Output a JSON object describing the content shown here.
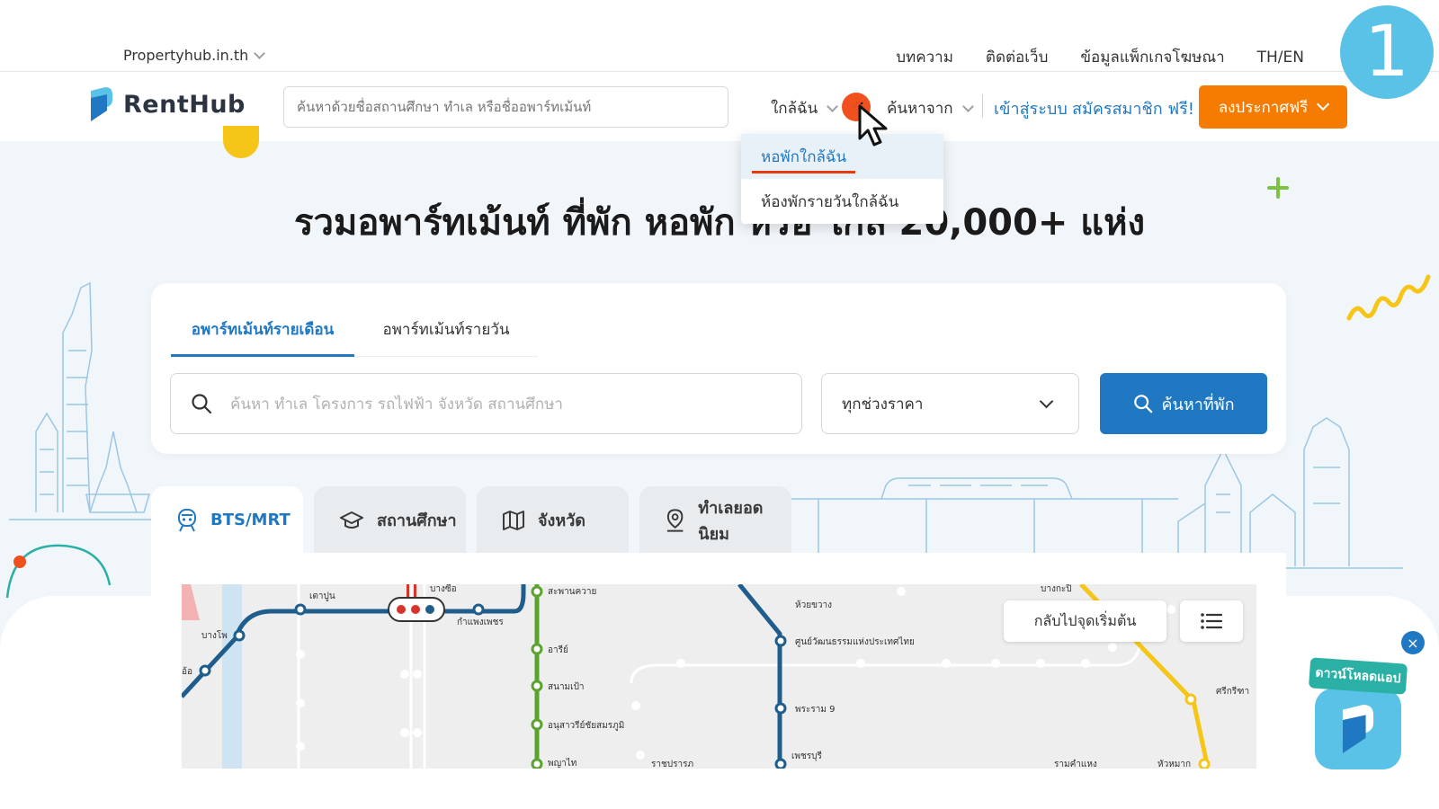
{
  "step_number": "1",
  "topbar": {
    "site": "Propertyhub.in.th",
    "links": [
      "บทความ",
      "ติดต่อเว็บ",
      "ข้อมูลแพ็กเกจโฆษณา"
    ],
    "language": "TH/EN"
  },
  "header": {
    "brand": "RentHub",
    "search_placeholder": "ค้นหาด้วยชื่อสถานศึกษา ทำเล หรือชื่ออพาร์ทเม้นท์",
    "near_me": "ใกล้ฉัน",
    "search_from": "ค้นหาจาก",
    "login": "เข้าสู่ระบบ",
    "register": "สมัครสมาชิก ฟรี!",
    "post_free": "ลงประกาศฟรี"
  },
  "dropdown": {
    "items": [
      "หอพักใกล้ฉัน",
      "ห้องพักรายวันใกล้ฉัน"
    ],
    "active_index": 0
  },
  "hero": {
    "title": "รวมอพาร์ทเม้นท์ ที่พัก หอพัก หรือ ใกล้ 20,000+ แห่ง"
  },
  "search_card": {
    "tabs": [
      "อพาร์ทเม้นท์รายเดือน",
      "อพาร์ทเม้นท์รายวัน"
    ],
    "active_tab": 0,
    "search_placeholder": "ค้นหา ทำเล โครงการ รถไฟฟ้า จังหวัด สถานศึกษา",
    "price_select": "ทุกช่วงราคา",
    "search_button": "ค้นหาที่พัก"
  },
  "category_tabs": [
    "BTS/MRT",
    "สถานศึกษา",
    "จังหวัด",
    "ทำเลยอดนิยม"
  ],
  "map": {
    "reset_button": "กลับไปจุดเริ่มต้น",
    "stations": [
      "เตาปูน",
      "บางซื่อ",
      "บางโพ",
      "อ้อ",
      "กำแพงเพชร",
      "สะพานควาย",
      "อารีย์",
      "สนามเป้า",
      "อนุสาวรีย์ชัยสมรภูมิ",
      "พญาไท",
      "ราชปรารภ",
      "ห้วยขวาง",
      "ศูนย์วัฒนธรรมแห่งประเทศไทย",
      "พระราม 9",
      "เพชรบุรี",
      "บางกะปิ",
      "ศรีกรีฑา",
      "รามคำแหง",
      "หัวหมาก"
    ]
  },
  "app_promo": {
    "label": "ดาวน์โหลดแอป",
    "close": "×"
  },
  "colors": {
    "primary": "#1f78c1",
    "accent_orange": "#f57c00",
    "click_marker": "#f0501d",
    "hero_bg": "#f1f6fa"
  }
}
